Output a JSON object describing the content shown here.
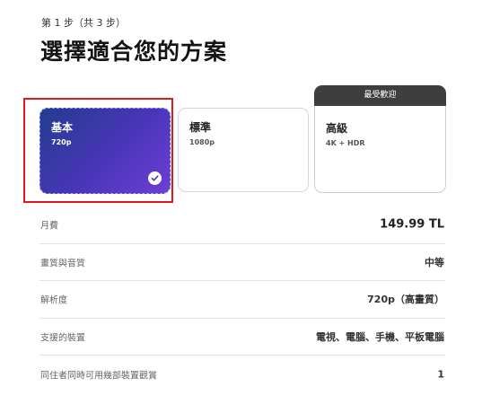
{
  "step_label": "第 1 步（共 3 步）",
  "page_title": "選擇適合您的方案",
  "plans": [
    {
      "name": "基本",
      "resolution": "720p",
      "selected": true
    },
    {
      "name": "標準",
      "resolution": "1080p",
      "selected": false
    },
    {
      "name": "高級",
      "resolution": "4K + HDR",
      "selected": false,
      "badge": "最受歡迎"
    }
  ],
  "features": [
    {
      "label": "月費",
      "value": "149.99 TL"
    },
    {
      "label": "畫質與音質",
      "value": "中等"
    },
    {
      "label": "解析度",
      "value": "720p（高畫質）"
    },
    {
      "label": "支援的裝置",
      "value": "電視、電腦、手機、平板電腦"
    },
    {
      "label": "同住者同時可用幾部裝置觀賞",
      "value": "1"
    }
  ],
  "colors": {
    "selected_gradient_start": "#223d8f",
    "selected_gradient_end": "#6e3fd6",
    "badge_bg": "#3e3e3e",
    "highlight_border": "#e01919"
  },
  "icons": {
    "selected_check": "check-circle-icon"
  }
}
